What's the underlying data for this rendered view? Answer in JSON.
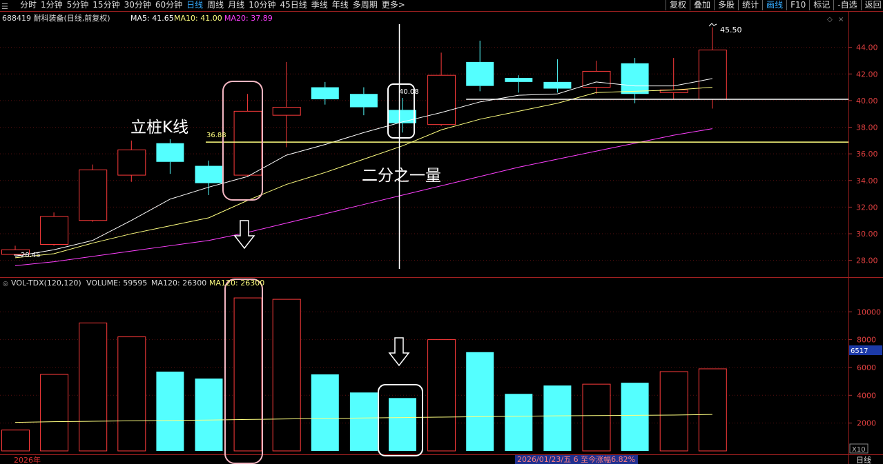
{
  "toolbar": {
    "left_tabs": [
      "分时",
      "1分钟",
      "5分钟",
      "15分钟",
      "30分钟",
      "60分钟",
      "日线",
      "周线",
      "月线",
      "10分钟",
      "45日线",
      "季线",
      "年线",
      "多周期",
      "更多>"
    ],
    "active_left": "日线",
    "right_tabs": [
      "复权",
      "叠加",
      "多股",
      "统计",
      "画线",
      "F10",
      "标记",
      "-自选",
      "返回"
    ],
    "active_right": "画线"
  },
  "price_header": {
    "stock": "688419 耐科装备(日线,前复权)",
    "ma5": "MA5: 41.65",
    "ma10": "MA10: 41.00",
    "ma20": "MA20: 37.89"
  },
  "volume_header": {
    "indicator": "VOL-TDX(120,120)",
    "volume": "VOLUME: 59595",
    "ma120a": "MA120: 26300",
    "ma120b": "MA120: 26300"
  },
  "annotations": {
    "lizhuang": "立桩K线",
    "half_volume": "二分之一量",
    "high_label": "45.50",
    "low_label": "28.45",
    "support_label": "36.88",
    "crosshair_label": "40.08"
  },
  "footer": {
    "year": "2026年",
    "status": "2026/01/23/五 6 至今涨幅6.82%",
    "x10": "X10",
    "period": "日线",
    "volume_marker": "6517"
  },
  "colors": {
    "up": "#ff3b3b",
    "down": "#54ffff",
    "ma5": "#ffffff",
    "ma10": "#ffff80",
    "ma20": "#ff40ff",
    "axis": "#b03030",
    "annotation_box": "#f4b6c2"
  },
  "chart_data": [
    {
      "type": "candlestick",
      "title": "688419 耐科装备(日线,前复权)",
      "y_ticks": [
        28.0,
        30.0,
        32.0,
        34.0,
        36.0,
        38.0,
        40.0,
        42.0,
        44.0
      ],
      "ylim": [
        27.0,
        46.0
      ],
      "candles": [
        {
          "open": 28.45,
          "high": 29.1,
          "low": 28.4,
          "close": 28.8,
          "dir": "up"
        },
        {
          "open": 29.2,
          "high": 31.6,
          "low": 29.1,
          "close": 31.3,
          "dir": "up"
        },
        {
          "open": 31.0,
          "high": 35.2,
          "low": 30.9,
          "close": 34.8,
          "dir": "up"
        },
        {
          "open": 34.4,
          "high": 37.0,
          "low": 33.9,
          "close": 36.3,
          "dir": "up"
        },
        {
          "open": 36.8,
          "high": 37.1,
          "low": 34.5,
          "close": 35.4,
          "dir": "down"
        },
        {
          "open": 35.1,
          "high": 35.5,
          "low": 32.9,
          "close": 33.8,
          "dir": "down"
        },
        {
          "open": 34.4,
          "high": 40.5,
          "low": 34.3,
          "close": 39.2,
          "dir": "up"
        },
        {
          "open": 38.9,
          "high": 42.9,
          "low": 36.5,
          "close": 39.5,
          "dir": "up"
        },
        {
          "open": 41.0,
          "high": 41.4,
          "low": 39.7,
          "close": 40.1,
          "dir": "down"
        },
        {
          "open": 40.5,
          "high": 41.0,
          "low": 38.9,
          "close": 39.5,
          "dir": "down"
        },
        {
          "open": 39.3,
          "high": 40.2,
          "low": 37.6,
          "close": 38.3,
          "dir": "down"
        },
        {
          "open": 38.2,
          "high": 43.6,
          "low": 38.1,
          "close": 41.9,
          "dir": "up"
        },
        {
          "open": 42.9,
          "high": 44.5,
          "low": 40.7,
          "close": 41.1,
          "dir": "down"
        },
        {
          "open": 41.7,
          "high": 41.9,
          "low": 40.6,
          "close": 41.4,
          "dir": "down"
        },
        {
          "open": 41.4,
          "high": 43.1,
          "low": 40.6,
          "close": 40.9,
          "dir": "down"
        },
        {
          "open": 41.0,
          "high": 43.0,
          "low": 40.5,
          "close": 42.2,
          "dir": "up"
        },
        {
          "open": 42.8,
          "high": 43.2,
          "low": 39.8,
          "close": 40.5,
          "dir": "down"
        },
        {
          "open": 40.6,
          "high": 43.2,
          "low": 40.1,
          "close": 40.8,
          "dir": "up"
        },
        {
          "open": 40.1,
          "high": 45.5,
          "low": 39.4,
          "close": 43.8,
          "dir": "up"
        }
      ],
      "ma5": [
        28.3,
        28.8,
        29.5,
        31.0,
        32.6,
        33.5,
        34.3,
        35.9,
        36.7,
        37.6,
        38.4,
        39.1,
        39.9,
        40.4,
        40.5,
        41.4,
        41.1,
        41.1,
        41.65
      ],
      "ma10": [
        28.2,
        28.5,
        29.3,
        30.0,
        30.6,
        31.2,
        32.5,
        33.7,
        34.6,
        35.6,
        36.6,
        37.8,
        38.6,
        39.2,
        39.8,
        40.6,
        40.7,
        40.8,
        41.0
      ],
      "ma20": [
        27.6,
        27.9,
        28.3,
        28.7,
        29.1,
        29.5,
        30.1,
        30.8,
        31.5,
        32.2,
        32.9,
        33.6,
        34.3,
        35.0,
        35.6,
        36.2,
        36.8,
        37.4,
        37.89
      ],
      "support_lines": [
        40.1,
        36.88
      ]
    },
    {
      "type": "bar",
      "title": "VOL-TDX(120,120)",
      "y_ticks": [
        2000,
        4000,
        6000,
        8000,
        10000
      ],
      "ylim": [
        0,
        11500
      ],
      "values": [
        1500,
        5500,
        9200,
        8200,
        5700,
        5200,
        11000,
        10900,
        5500,
        4200,
        3800,
        8000,
        7100,
        4100,
        4700,
        4800,
        4900,
        5700,
        5900
      ],
      "directions": [
        "up",
        "up",
        "up",
        "up",
        "down",
        "down",
        "up",
        "up",
        "down",
        "down",
        "down",
        "up",
        "down",
        "down",
        "down",
        "up",
        "down",
        "up",
        "up"
      ],
      "ma120": [
        2050,
        2100,
        2130,
        2160,
        2190,
        2220,
        2260,
        2300,
        2330,
        2370,
        2400,
        2430,
        2460,
        2490,
        2520,
        2540,
        2560,
        2580,
        2620
      ]
    }
  ]
}
